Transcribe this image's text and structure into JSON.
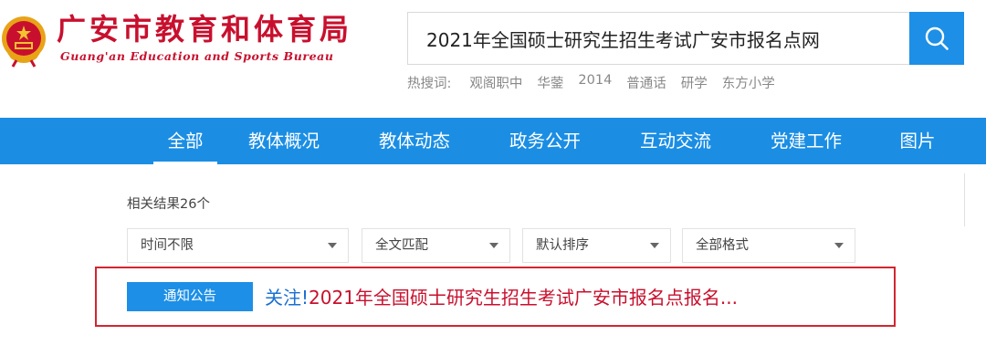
{
  "header": {
    "site_title": "广安市教育和体育局",
    "site_subtitle": "Guang'an Education and Sports Bureau"
  },
  "search": {
    "query": "2021年全国硕士研究生招生考试广安市报名点网",
    "icon": "search-icon"
  },
  "hot_searches": {
    "label": "热搜词:",
    "items": [
      "观阁职中",
      "华蓥",
      "2014",
      "普通话",
      "研学",
      "东方小学"
    ]
  },
  "nav": {
    "items": [
      {
        "label": "全部",
        "active": true
      },
      {
        "label": "教体概况"
      },
      {
        "label": "教体动态"
      },
      {
        "label": "政务公开"
      },
      {
        "label": "互动交流"
      },
      {
        "label": "党建工作"
      },
      {
        "label": "图片"
      }
    ]
  },
  "results": {
    "count_text": "相关结果26个",
    "filters": [
      "时间不限",
      "全文匹配",
      "默认排序",
      "全部格式"
    ],
    "items": [
      {
        "category": "通知公告",
        "title_prefix": "关注!",
        "title": "2021年全国硕士研究生招生考试广安市报名点报名..."
      }
    ]
  },
  "colors": {
    "brand_red": "#c8102e",
    "nav_blue": "#1b8ee4",
    "accent_blue": "#1d8fe6",
    "highlight_red": "#d22630"
  }
}
